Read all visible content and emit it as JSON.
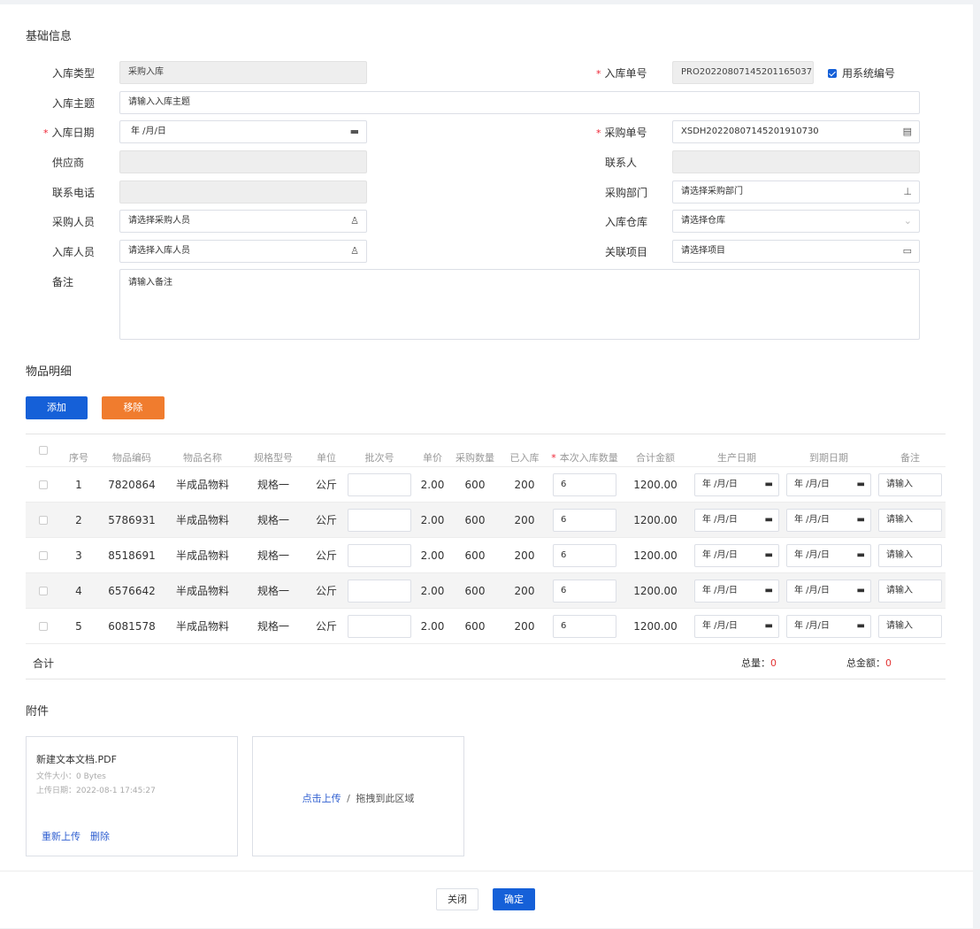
{
  "basic": {
    "title": "基础信息",
    "fields": {
      "type": {
        "label": "入库类型",
        "value": "采购入库"
      },
      "order_no": {
        "label": "入库单号",
        "value": "PRO20220807145201165037"
      },
      "use_sys_no": {
        "label": "用系统编号",
        "checked": true
      },
      "subject": {
        "label": "入库主题",
        "placeholder": "请输入入库主题"
      },
      "date": {
        "label": "入库日期",
        "value": "年 /月/日"
      },
      "purchase_no": {
        "label": "采购单号",
        "value": "XSDH20220807145201910730"
      },
      "supplier": {
        "label": "供应商",
        "value": ""
      },
      "contact": {
        "label": "联系人",
        "value": ""
      },
      "phone": {
        "label": "联系电话",
        "value": ""
      },
      "dept": {
        "label": "采购部门",
        "placeholder": "请选择采购部门"
      },
      "buyer": {
        "label": "采购人员",
        "placeholder": "请选择采购人员"
      },
      "warehouse": {
        "label": "入库仓库",
        "placeholder": "请选择仓库"
      },
      "stocker": {
        "label": "入库人员",
        "placeholder": "请选择入库人员"
      },
      "project": {
        "label": "关联项目",
        "placeholder": "请选择项目"
      },
      "remark": {
        "label": "备注",
        "placeholder": "请输入备注"
      }
    }
  },
  "items": {
    "title": "物品明细",
    "add_label": "添加",
    "remove_label": "移除",
    "headers": [
      "序号",
      "物品编码",
      "物品名称",
      "规格型号",
      "单位",
      "批次号",
      "单价",
      "采购数量",
      "已入库",
      "本次入库数量",
      "合计金额",
      "生产日期",
      "到期日期",
      "备注"
    ],
    "rows": [
      {
        "idx": "1",
        "code": "7820864",
        "name": "半成品物料",
        "spec": "规格一",
        "unit": "公斤",
        "batch": "",
        "price": "2.00",
        "qty": "600",
        "received": "200",
        "this_qty": "6",
        "amount": "1200.00",
        "mfg": "年 /月/日",
        "exp": "年 /月/日",
        "note": "请输入"
      },
      {
        "idx": "2",
        "code": "5786931",
        "name": "半成品物料",
        "spec": "规格一",
        "unit": "公斤",
        "batch": "",
        "price": "2.00",
        "qty": "600",
        "received": "200",
        "this_qty": "6",
        "amount": "1200.00",
        "mfg": "年 /月/日",
        "exp": "年 /月/日",
        "note": "请输入"
      },
      {
        "idx": "3",
        "code": "8518691",
        "name": "半成品物料",
        "spec": "规格一",
        "unit": "公斤",
        "batch": "",
        "price": "2.00",
        "qty": "600",
        "received": "200",
        "this_qty": "6",
        "amount": "1200.00",
        "mfg": "年 /月/日",
        "exp": "年 /月/日",
        "note": "请输入"
      },
      {
        "idx": "4",
        "code": "6576642",
        "name": "半成品物料",
        "spec": "规格一",
        "unit": "公斤",
        "batch": "",
        "price": "2.00",
        "qty": "600",
        "received": "200",
        "this_qty": "6",
        "amount": "1200.00",
        "mfg": "年 /月/日",
        "exp": "年 /月/日",
        "note": "请输入"
      },
      {
        "idx": "5",
        "code": "6081578",
        "name": "半成品物料",
        "spec": "规格一",
        "unit": "公斤",
        "batch": "",
        "price": "2.00",
        "qty": "600",
        "received": "200",
        "this_qty": "6",
        "amount": "1200.00",
        "mfg": "年 /月/日",
        "exp": "年 /月/日",
        "note": "请输入"
      }
    ],
    "summary": {
      "label": "合计",
      "total_qty_label": "总量：",
      "total_qty": "0",
      "total_amount_label": "总金额：",
      "total_amount": "0"
    }
  },
  "attachments": {
    "title": "附件",
    "file": {
      "name": "新建文本文档.PDF",
      "size": "文件大小：0 Bytes",
      "date": "上传日期：2022-08-1 17:45:27",
      "reupload_label": "重新上传",
      "delete_label": "删除"
    },
    "upload": {
      "link_label": "点击上传",
      "separator": "/",
      "hint": "拖拽到此区域"
    }
  },
  "footer": {
    "close_label": "关闭",
    "confirm_label": "确定"
  },
  "colors": {
    "primary": "#1560d8",
    "warning": "#f07c2e",
    "required": "#e23333",
    "link": "#2f5fd0"
  }
}
